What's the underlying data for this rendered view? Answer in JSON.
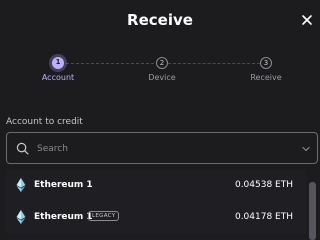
{
  "modal": {
    "title": "Receive",
    "close_icon": "close-icon"
  },
  "steps": [
    {
      "number": "1",
      "label": "Account",
      "state": "active"
    },
    {
      "number": "2",
      "label": "Device",
      "state": "inactive"
    },
    {
      "number": "3",
      "label": "Receive",
      "state": "inactive"
    }
  ],
  "account_section": {
    "label": "Account to credit",
    "search_placeholder": "Search",
    "search_value": "",
    "search_icon": "search-icon",
    "dropdown_icon": "chevron-down-icon"
  },
  "accounts": [
    {
      "name": "Ethereum 1",
      "badge": "",
      "balance": "0.04538 ETH",
      "icon": "ethereum-icon"
    },
    {
      "name": "Ethereum 1",
      "badge": "LEGACY",
      "balance": "0.04178 ETH",
      "icon": "ethereum-icon"
    }
  ],
  "colors": {
    "background": "#1c1c1f",
    "accent": "#bbb0ff",
    "text": "#ffffff",
    "muted": "#9a9aa2"
  }
}
